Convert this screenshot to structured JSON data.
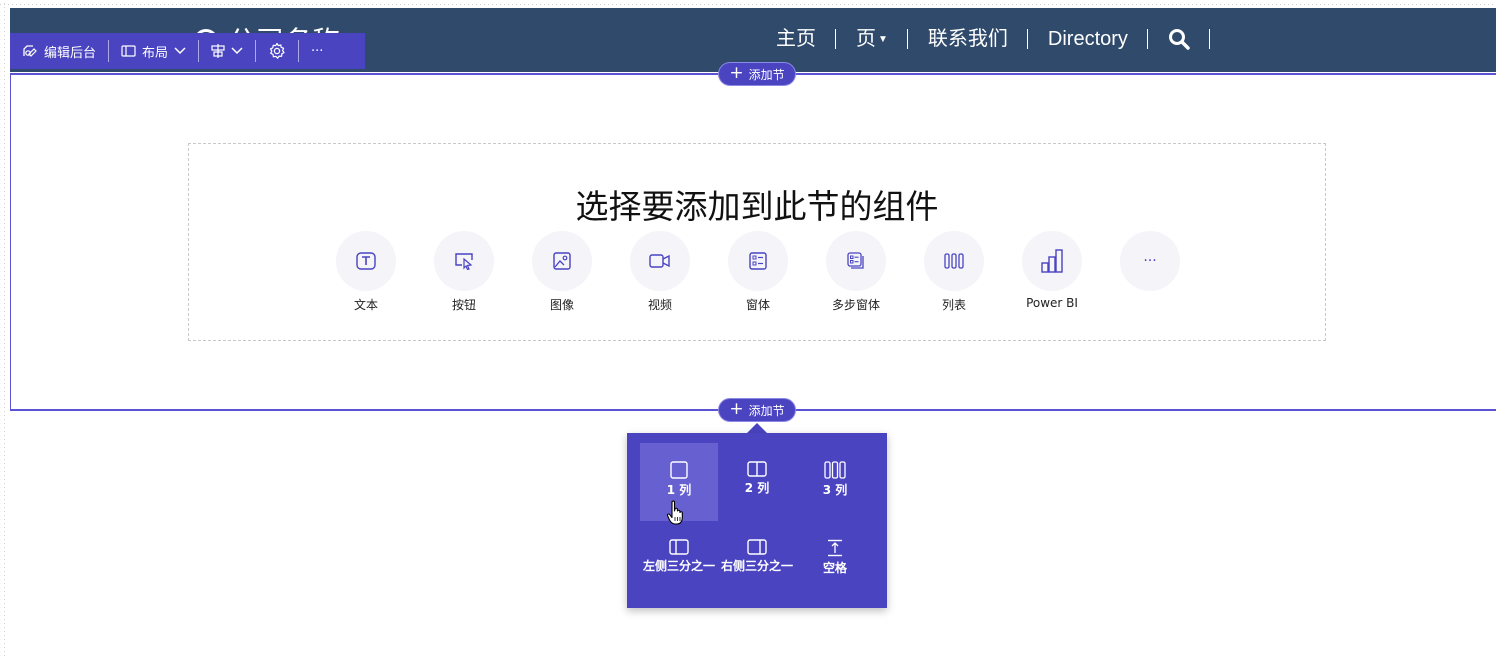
{
  "header": {
    "brand": "公司名称",
    "nav": [
      {
        "label": "主页",
        "caret": false
      },
      {
        "label": "页",
        "caret": true
      },
      {
        "label": "联系我们",
        "caret": false
      },
      {
        "label": "Directory",
        "caret": false
      }
    ],
    "search_icon": "search-icon"
  },
  "toolbar": {
    "edit_backend_label": "编辑后台",
    "layout_label": "布局",
    "icons": [
      "edit-site-icon",
      "layout-icon",
      "chevron-down-icon",
      "align-icon",
      "settings-icon",
      "more-icon"
    ],
    "more_label": "···"
  },
  "add_section": {
    "label": "添加节"
  },
  "placeholder": {
    "title": "选择要添加到此节的组件",
    "components": [
      {
        "label": "文本",
        "icon": "text-icon"
      },
      {
        "label": "按钮",
        "icon": "button-icon"
      },
      {
        "label": "图像",
        "icon": "image-icon"
      },
      {
        "label": "视频",
        "icon": "video-icon"
      },
      {
        "label": "窗体",
        "icon": "form-icon"
      },
      {
        "label": "多步窗体",
        "icon": "multistep-form-icon"
      },
      {
        "label": "列表",
        "icon": "list-icon"
      },
      {
        "label": "Power BI",
        "icon": "powerbi-icon"
      },
      {
        "label": "",
        "icon": "more-icon",
        "glyph": "···"
      }
    ]
  },
  "layout_popover": {
    "options": [
      {
        "label": "1 列",
        "icon": "one-column-icon",
        "hovered": true
      },
      {
        "label": "2 列",
        "icon": "two-column-icon"
      },
      {
        "label": "3 列",
        "icon": "three-column-icon"
      },
      {
        "label": "左侧三分之一",
        "icon": "left-third-icon"
      },
      {
        "label": "右侧三分之一",
        "icon": "right-third-icon"
      },
      {
        "label": "空格",
        "icon": "spacer-icon"
      }
    ]
  },
  "colors": {
    "header_bg": "#2f4a6b",
    "accent": "#4a44c1",
    "accent_hover": "#6660d0",
    "outline": "#5a54d4"
  }
}
